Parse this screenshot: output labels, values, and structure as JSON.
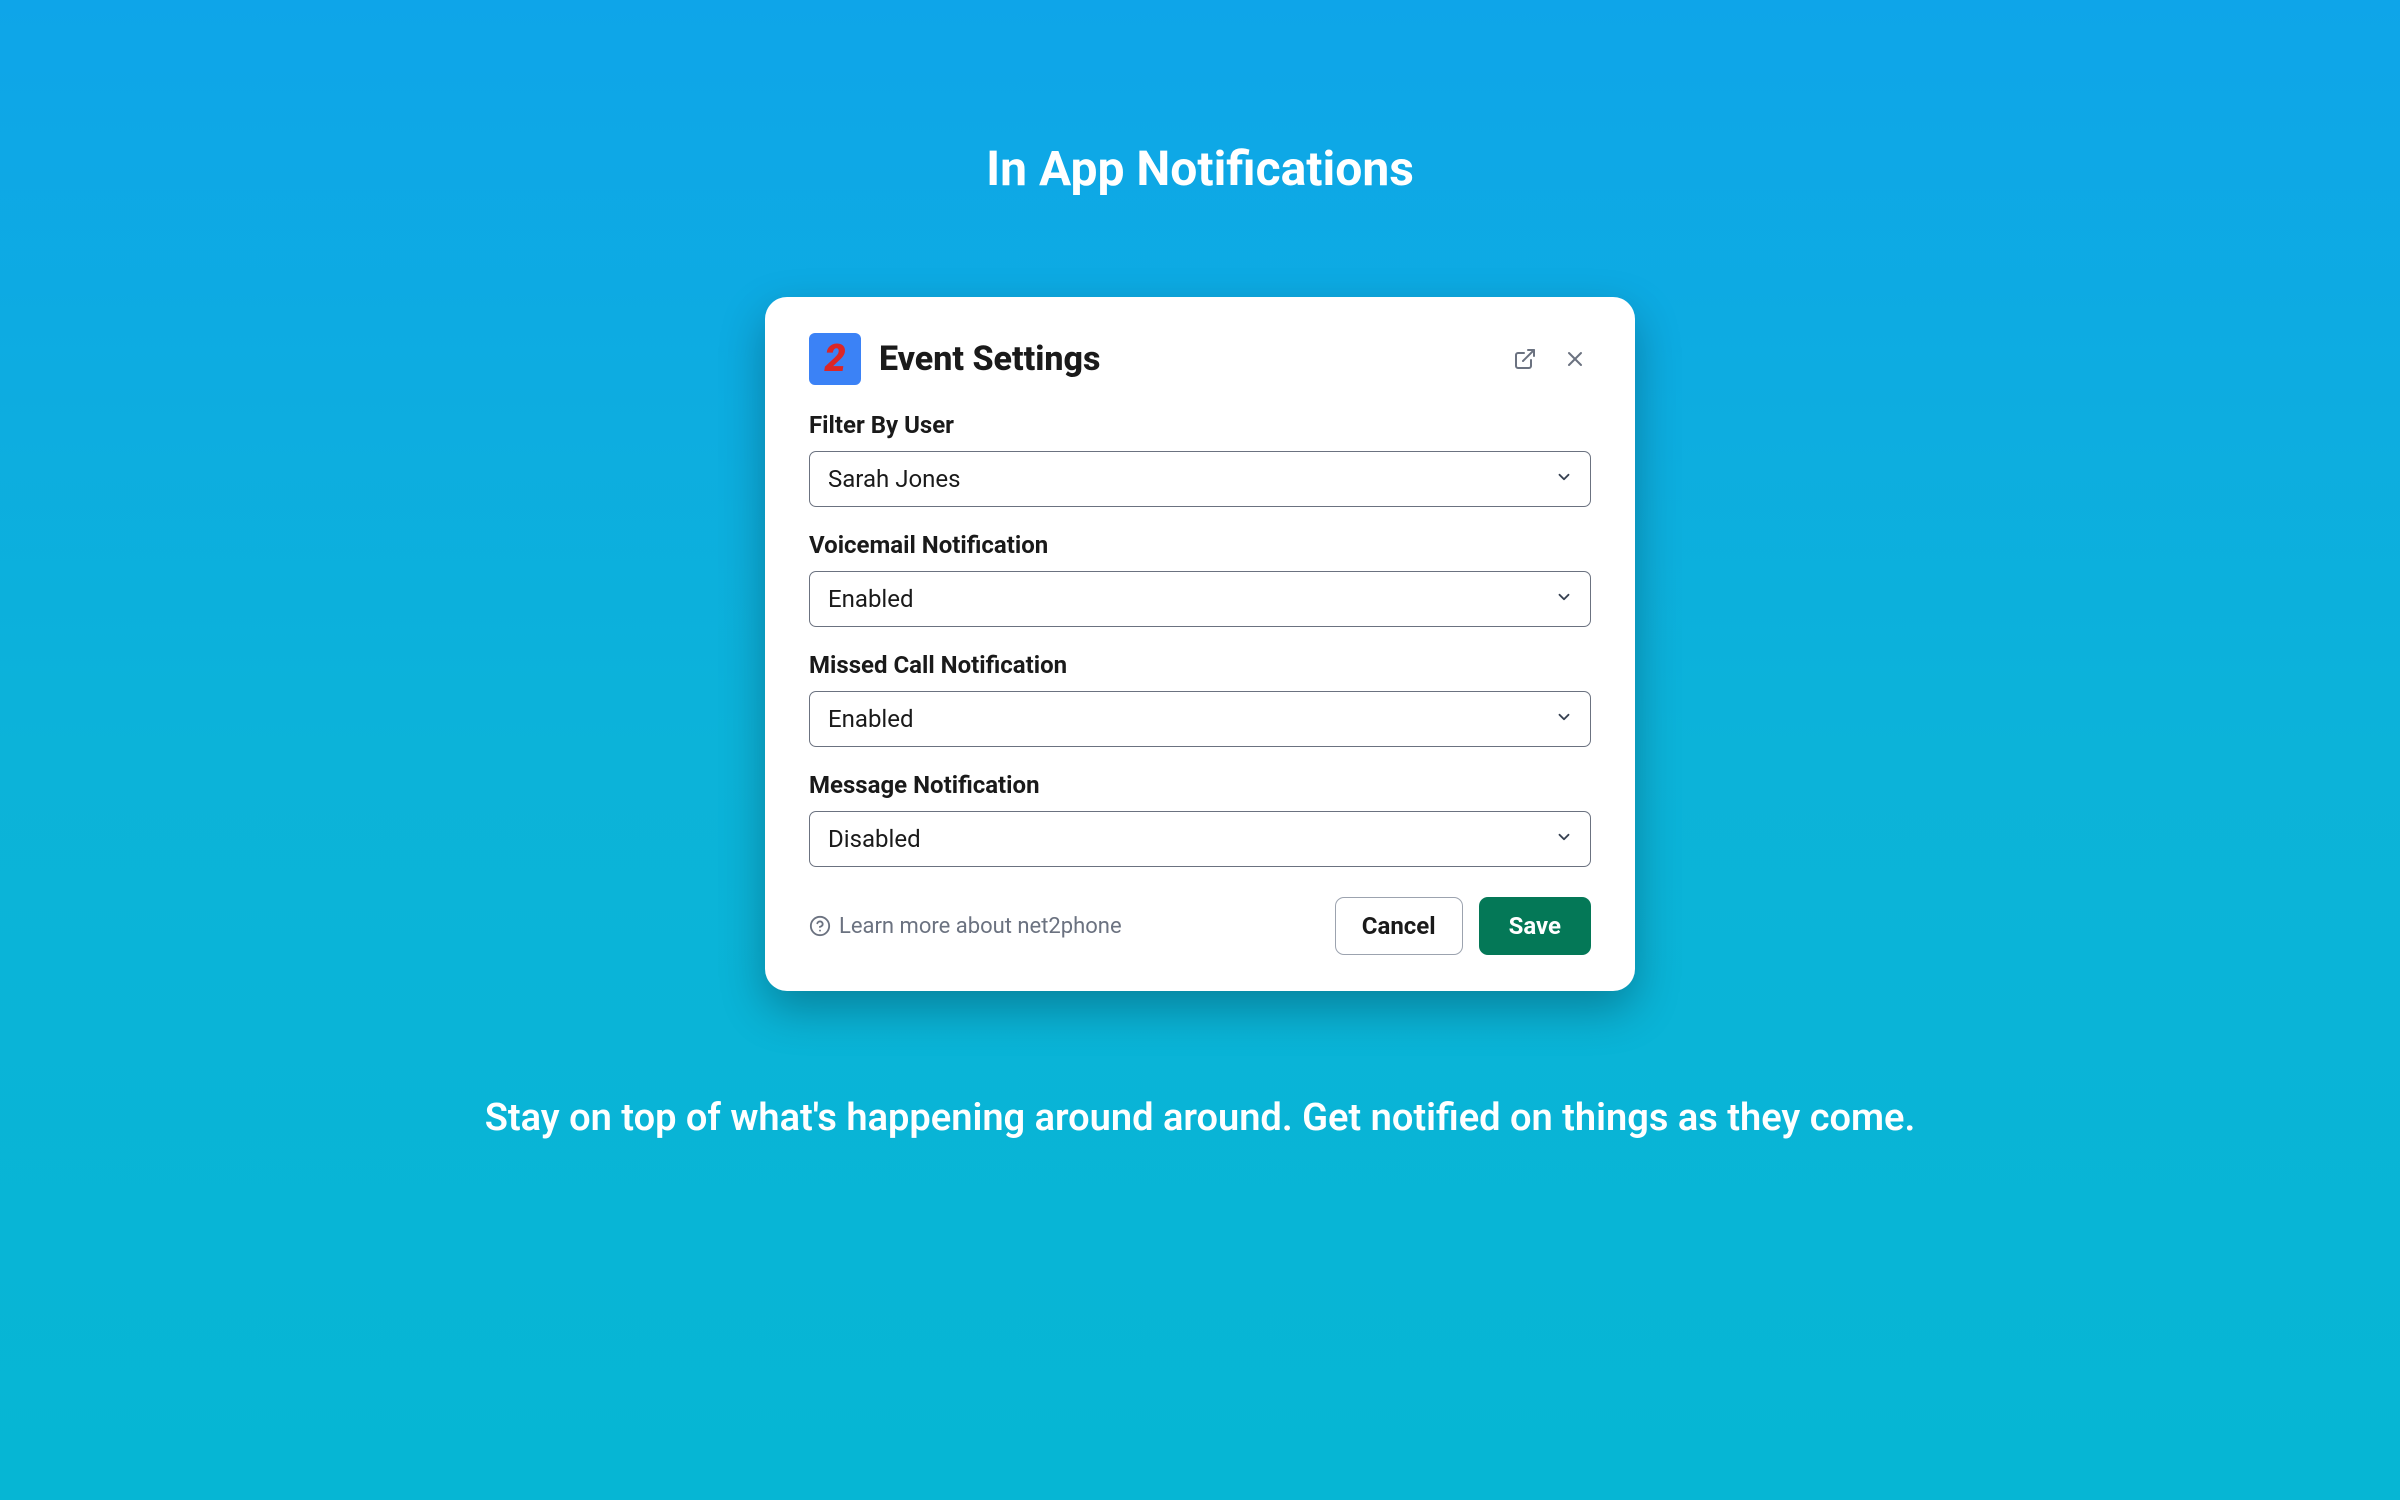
{
  "page": {
    "title": "In App Notifications",
    "subtitle": "Stay on top of what's happening around around. Get notified on things as they come."
  },
  "modal": {
    "logoText": "2",
    "title": "Event Settings",
    "fields": [
      {
        "label": "Filter By User",
        "value": "Sarah Jones"
      },
      {
        "label": "Voicemail Notification",
        "value": "Enabled"
      },
      {
        "label": "Missed Call Notification",
        "value": "Enabled"
      },
      {
        "label": "Message Notification",
        "value": "Disabled"
      }
    ],
    "helpText": "Learn more about net2phone",
    "cancelLabel": "Cancel",
    "saveLabel": "Save"
  }
}
